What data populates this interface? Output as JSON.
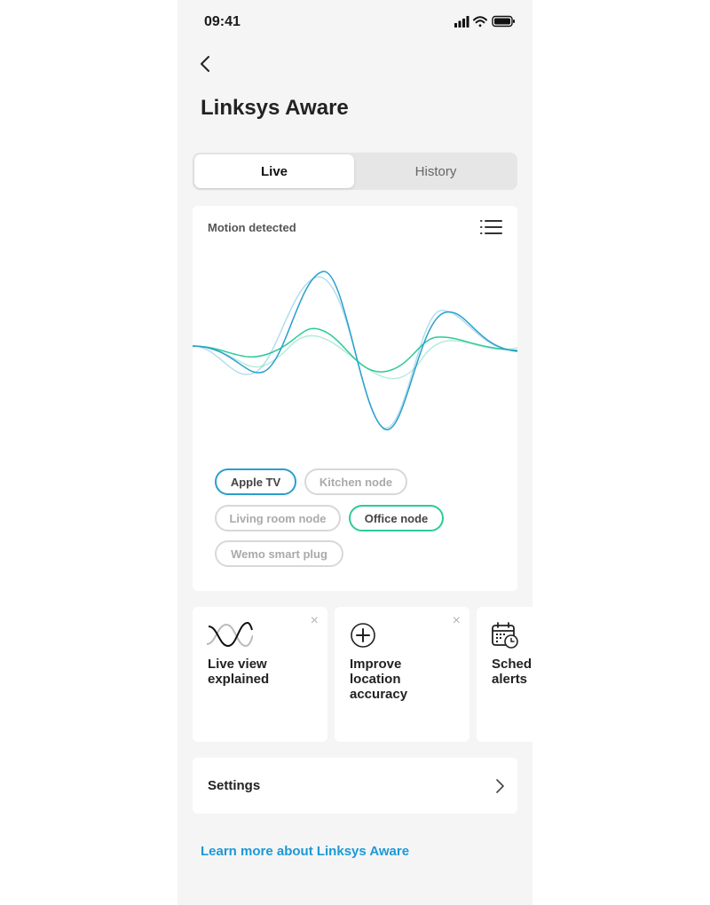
{
  "status_bar": {
    "time": "09:41"
  },
  "header": {
    "title": "Linksys Aware"
  },
  "tabs": [
    {
      "label": "Live",
      "active": true
    },
    {
      "label": "History",
      "active": false
    }
  ],
  "motion_card": {
    "title": "Motion detected",
    "chips": [
      {
        "label": "Apple TV",
        "state": "selected-blue"
      },
      {
        "label": "Kitchen node",
        "state": "unselected"
      },
      {
        "label": "Living room node",
        "state": "unselected"
      },
      {
        "label": "Office node",
        "state": "selected-green"
      },
      {
        "label": "Wemo smart plug",
        "state": "unselected"
      }
    ]
  },
  "tiles": [
    {
      "text": "Live view explained",
      "icon": "waves-icon",
      "dismissible": true
    },
    {
      "text": "Improve location accuracy",
      "icon": "plus-circle-icon",
      "dismissible": true
    },
    {
      "text": "Sched alerts",
      "icon": "calendar-clock-icon",
      "dismissible": false
    }
  ],
  "settings": {
    "label": "Settings"
  },
  "footer": {
    "link": "Learn more about Linksys Aware"
  },
  "colors": {
    "accent_blue": "#2a9fcd",
    "accent_green": "#2dc99a",
    "link": "#1a9ad6"
  }
}
